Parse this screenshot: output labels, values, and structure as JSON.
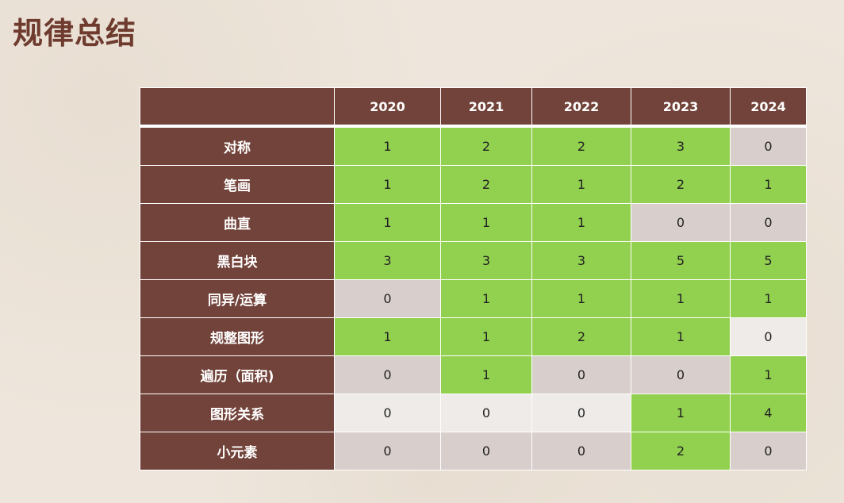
{
  "title": "规律总结",
  "columns": [
    "",
    "2020",
    "2021",
    "2022",
    "2023",
    "2024"
  ],
  "colors": {
    "header_bg": "#72433a",
    "green": "#92d050",
    "gray": "#d8cecb",
    "light": "#eeebe8",
    "title": "#6e3b2e"
  },
  "rows": [
    {
      "label": "对称",
      "values": [
        "1",
        "2",
        "2",
        "3",
        "0"
      ],
      "fills": [
        "green",
        "green",
        "green",
        "green",
        "gray"
      ]
    },
    {
      "label": "笔画",
      "values": [
        "1",
        "2",
        "1",
        "2",
        "1"
      ],
      "fills": [
        "green",
        "green",
        "green",
        "green",
        "green"
      ]
    },
    {
      "label": "曲直",
      "values": [
        "1",
        "1",
        "1",
        "0",
        "0"
      ],
      "fills": [
        "green",
        "green",
        "green",
        "gray",
        "gray"
      ]
    },
    {
      "label": "黑白块",
      "values": [
        "3",
        "3",
        "3",
        "5",
        "5"
      ],
      "fills": [
        "green",
        "green",
        "green",
        "green",
        "green"
      ]
    },
    {
      "label": "同异/运算",
      "values": [
        "0",
        "1",
        "1",
        "1",
        "1"
      ],
      "fills": [
        "gray",
        "green",
        "green",
        "green",
        "green"
      ]
    },
    {
      "label": "规整图形",
      "values": [
        "1",
        "1",
        "2",
        "1",
        "0"
      ],
      "fills": [
        "green",
        "green",
        "green",
        "green",
        "light"
      ]
    },
    {
      "label": "遍历（面积)",
      "values": [
        "0",
        "1",
        "0",
        "0",
        "1"
      ],
      "fills": [
        "gray",
        "green",
        "gray",
        "gray",
        "green"
      ]
    },
    {
      "label": "图形关系",
      "values": [
        "0",
        "0",
        "0",
        "1",
        "4"
      ],
      "fills": [
        "light",
        "light",
        "light",
        "green",
        "green"
      ]
    },
    {
      "label": "小元素",
      "values": [
        "0",
        "0",
        "0",
        "2",
        "0"
      ],
      "fills": [
        "gray",
        "gray",
        "gray",
        "green",
        "gray"
      ]
    }
  ]
}
